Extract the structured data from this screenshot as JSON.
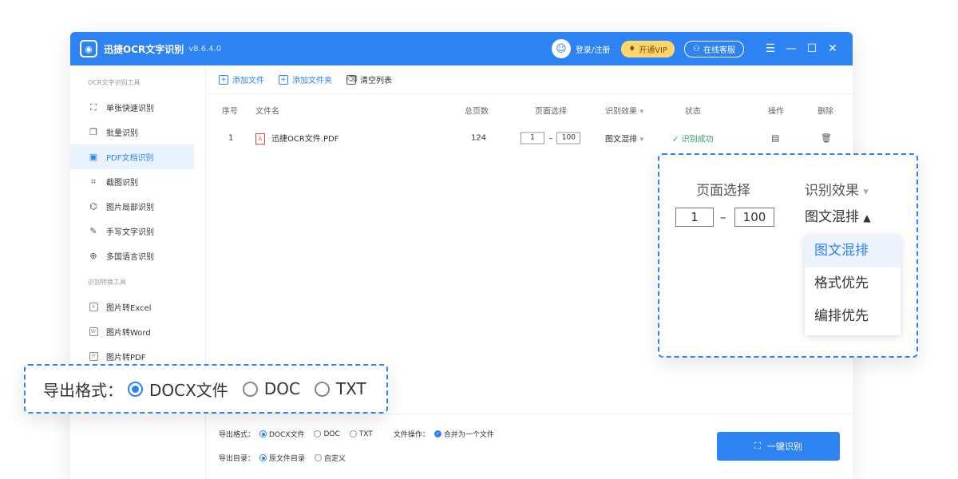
{
  "titlebar": {
    "app_name": "迅捷OCR文字识别",
    "version": "v8.6.4.0",
    "login": "登录/注册",
    "vip": "开通VIP",
    "service": "在线客服"
  },
  "sidebar": {
    "section1": "OCR文字识别工具",
    "items1": [
      {
        "label": "单张快速识别",
        "icon": "single-scan-icon"
      },
      {
        "label": "批量识别",
        "icon": "batch-icon"
      },
      {
        "label": "PDF文档识别",
        "icon": "pdf-doc-icon"
      },
      {
        "label": "截图识别",
        "icon": "crop-icon"
      },
      {
        "label": "图片局部识别",
        "icon": "partial-scan-icon"
      },
      {
        "label": "手写文字识别",
        "icon": "pen-icon"
      },
      {
        "label": "多国语言识别",
        "icon": "globe-icon"
      }
    ],
    "section2": "识别转换工具",
    "items2": [
      {
        "label": "图片转Excel",
        "icon": "excel-icon"
      },
      {
        "label": "图片转Word",
        "icon": "word-icon"
      },
      {
        "label": "图片转PDF",
        "icon": "pdf-icon"
      }
    ]
  },
  "toolbar": {
    "add_file": "添加文件",
    "add_folder": "添加文件夹",
    "clear_list": "清空列表"
  },
  "table": {
    "headers": [
      "序号",
      "文件名",
      "总页数",
      "页面选择",
      "识别效果",
      "状态",
      "操作",
      "删除"
    ],
    "row": {
      "index": "1",
      "filename": "迅捷OCR文件.PDF",
      "pages": "124",
      "page_from": "1",
      "page_to": "100",
      "effect": "图文混排",
      "status": "识别成功"
    }
  },
  "bottom": {
    "export_label": "导出格式：",
    "formats": [
      "DOCX文件",
      "DOC",
      "TXT"
    ],
    "selected_format": "DOCX文件",
    "file_op_label": "文件操作：",
    "merge": "合并为一个文件",
    "dir_label": "导出目录：",
    "dirs": [
      "原文件目录",
      "自定义"
    ],
    "run_button": "一键识别"
  },
  "callout_export": {
    "label": "导出格式：",
    "formats": [
      "DOCX文件",
      "DOC",
      "TXT"
    ]
  },
  "callout_page": {
    "page_header": "页面选择",
    "effect_header": "识别效果",
    "page_from": "1",
    "page_to": "100",
    "current": "图文混排",
    "options": [
      "图文混排",
      "格式优先",
      "编排优先"
    ]
  },
  "colors": {
    "accent": "#2d83f2",
    "success": "#2ca55d",
    "vip": "#ffd66b"
  }
}
